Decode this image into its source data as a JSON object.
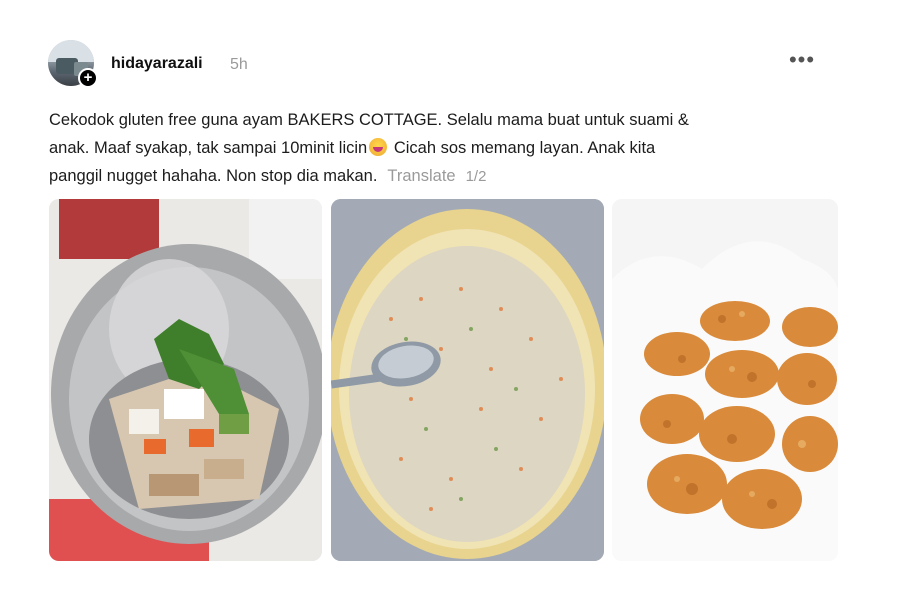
{
  "post": {
    "username": "hidayarazali",
    "timestamp": "5h",
    "more_icon": "more-horizontal-icon",
    "caption_lines": [
      "Cekodok gluten free guna ayam BAKERS COTTAGE. Selalu mama buat untuk suami &",
      "anak. Maaf syakap, tak sampai 10minit licin",
      " Cicah sos memang layan. Anak kita",
      "panggil nugget hahaha. Non stop dia makan."
    ],
    "emoji_icon": "laughing-tears-emoji-icon",
    "translate_label": "Translate",
    "image_indicator": "1/2",
    "images": [
      {
        "name": "mixing-bowl-photo",
        "depicts": "chopped chicken and vegetables in steel bowl"
      },
      {
        "name": "batter-bowl-photo",
        "depicts": "batter with spoon in yellow bowl"
      },
      {
        "name": "fried-fritters-photo",
        "depicts": "fried fritters on paper towel"
      }
    ]
  },
  "colors": {
    "text": "#101010",
    "muted": "#9a9a9a",
    "background": "#ffffff"
  }
}
